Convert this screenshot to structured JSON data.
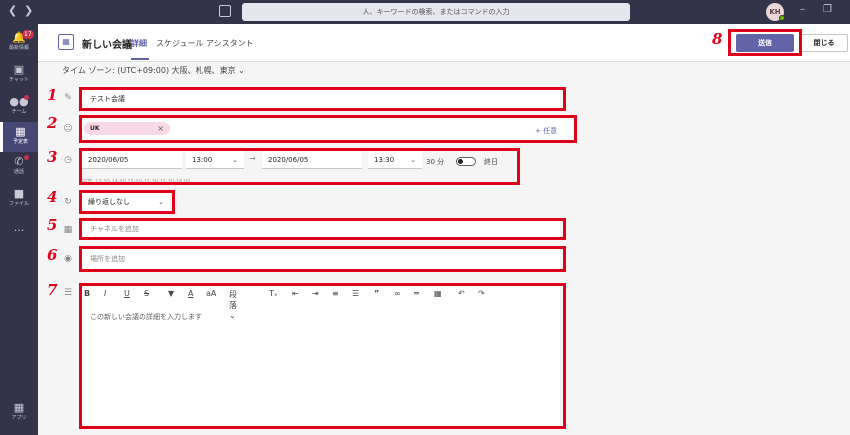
{
  "titlebar": {
    "back_icon": "chevron-left-icon",
    "forward_icon": "chevron-right-icon",
    "search_placeholder": "人、キーワードの検索、またはコマンドの入力",
    "avatar_initials": "KH",
    "presence_color": "#6bb700"
  },
  "rail": {
    "items": [
      {
        "label": "最新情報",
        "icon": "bell-icon",
        "badge": "17"
      },
      {
        "label": "チャット",
        "icon": "chat-icon"
      },
      {
        "label": "チーム",
        "icon": "teams-icon",
        "badge": "1"
      },
      {
        "label": "予定表",
        "icon": "calendar-icon",
        "active": true
      },
      {
        "label": "通話",
        "icon": "phone-icon"
      },
      {
        "label": "ファイル",
        "icon": "file-icon"
      },
      {
        "label": "...",
        "icon": "more-icon"
      },
      {
        "label": "アプリ",
        "icon": "apps-icon"
      }
    ]
  },
  "header": {
    "title": "新しい会議",
    "tabs": [
      {
        "label": "詳細",
        "active": true
      },
      {
        "label": "スケジュール アシスタント",
        "active": false
      }
    ],
    "send_label": "送信",
    "close_label": "閉じる"
  },
  "timezone": "タイム ゾーン: (UTC+09:00) 大阪、札幌、東京",
  "form": {
    "title_value": "テスト会議",
    "attendee_chip": "UK",
    "optional_label": "+ 任意",
    "start_date": "2020/06/05",
    "start_time": "13:00",
    "end_date": "2020/06/05",
    "end_time": "13:30",
    "duration": "30 分",
    "all_day_label": "終日",
    "suggestions": "提案: 13:30-14:00 15:00-15:30 15:30-16:00",
    "repeat_value": "繰り返しなし",
    "channel_placeholder": "チャネルを追加",
    "location_placeholder": "場所を追加",
    "details_placeholder": "この新しい会議の詳細を入力します",
    "toolbar_paragraph": "段落"
  },
  "annotations": {
    "steps": [
      "1",
      "2",
      "3",
      "4",
      "5",
      "6",
      "7",
      "8"
    ],
    "highlight_color": "#e0001b"
  },
  "colors": {
    "accent": "#6264a7",
    "rail_bg": "#33344a"
  }
}
